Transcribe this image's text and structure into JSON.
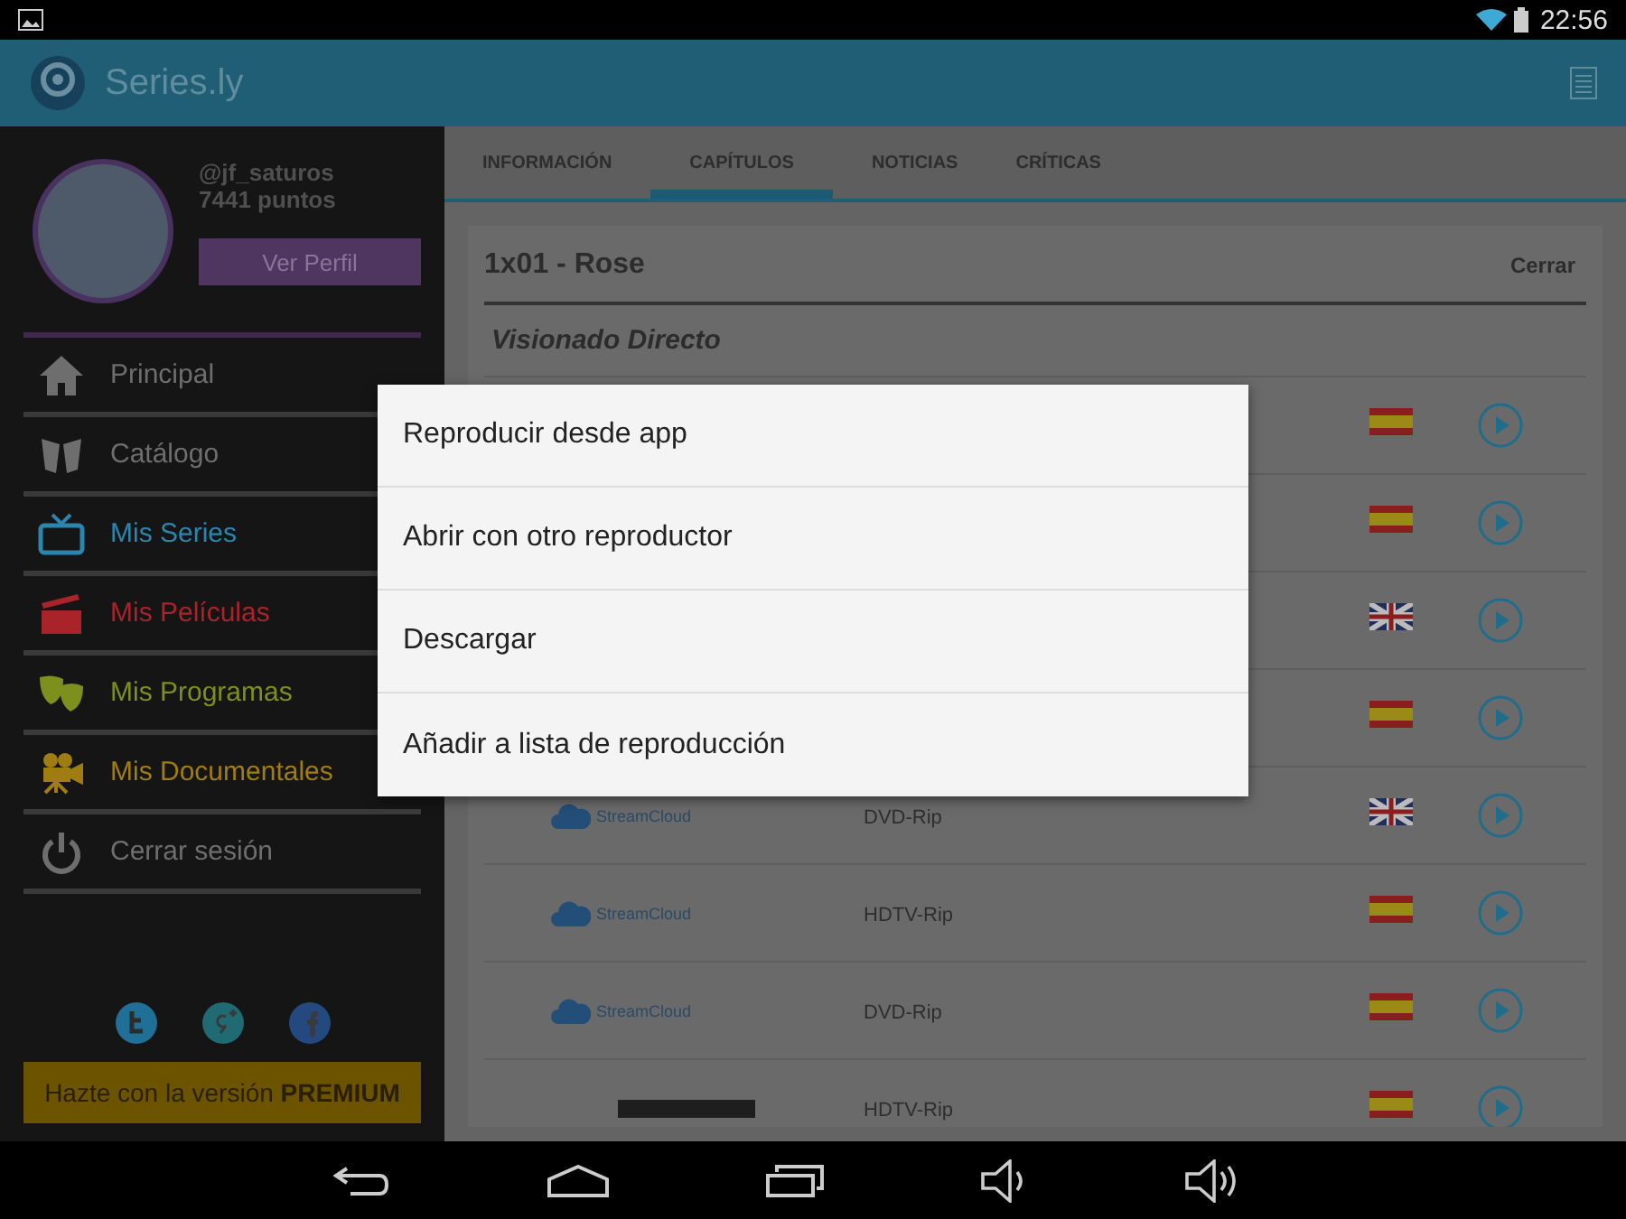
{
  "status_bar": {
    "time": "22:56"
  },
  "app_bar": {
    "title": "Series.ly"
  },
  "profile": {
    "username": "@jf_saturos",
    "points": "7441 puntos",
    "button": "Ver Perfil"
  },
  "sidebar": {
    "items": [
      {
        "label": "Principal",
        "color": "#6e6e6e"
      },
      {
        "label": "Catálogo",
        "color": "#6e6e6e"
      },
      {
        "label": "Mis Series",
        "color": "#2a86b0"
      },
      {
        "label": "Mis Películas",
        "color": "#a8242a"
      },
      {
        "label": "Mis Programas",
        "color": "#7d8f1c"
      },
      {
        "label": "Mis Documentales",
        "color": "#a07d12"
      },
      {
        "label": "Cerrar sesión",
        "color": "#6e6e6e"
      }
    ],
    "premium": "Hazte con la versión **PREMIUM**"
  },
  "tabs": [
    {
      "label": "INFORMACIÓN",
      "selected": false
    },
    {
      "label": "CAPÍTULOS",
      "selected": true
    },
    {
      "label": "NOTICIAS",
      "selected": false
    },
    {
      "label": "CRÍTICAS",
      "selected": false
    }
  ],
  "episode": {
    "title": "1x01 - Rose",
    "close": "Cerrar",
    "section": "Visionado Directo",
    "links": [
      {
        "kind": "es"
      },
      {
        "kind": "es"
      },
      {
        "kind": "uk"
      },
      {
        "kind": "es"
      },
      {
        "kind": "uk",
        "host": "StreamCloud",
        "quality": "DVD-Rip"
      },
      {
        "kind": "es",
        "host": "StreamCloud",
        "quality": "HDTV-Rip"
      },
      {
        "kind": "es",
        "host": "StreamCloud",
        "quality": "DVD-Rip"
      },
      {
        "kind": "es",
        "quality": "HDTV-Rip"
      }
    ]
  },
  "dialog": {
    "items": [
      "Reproducir desde app",
      "Abrir con otro reproductor",
      "Descargar",
      "Añadir a lista de reproducción"
    ]
  }
}
